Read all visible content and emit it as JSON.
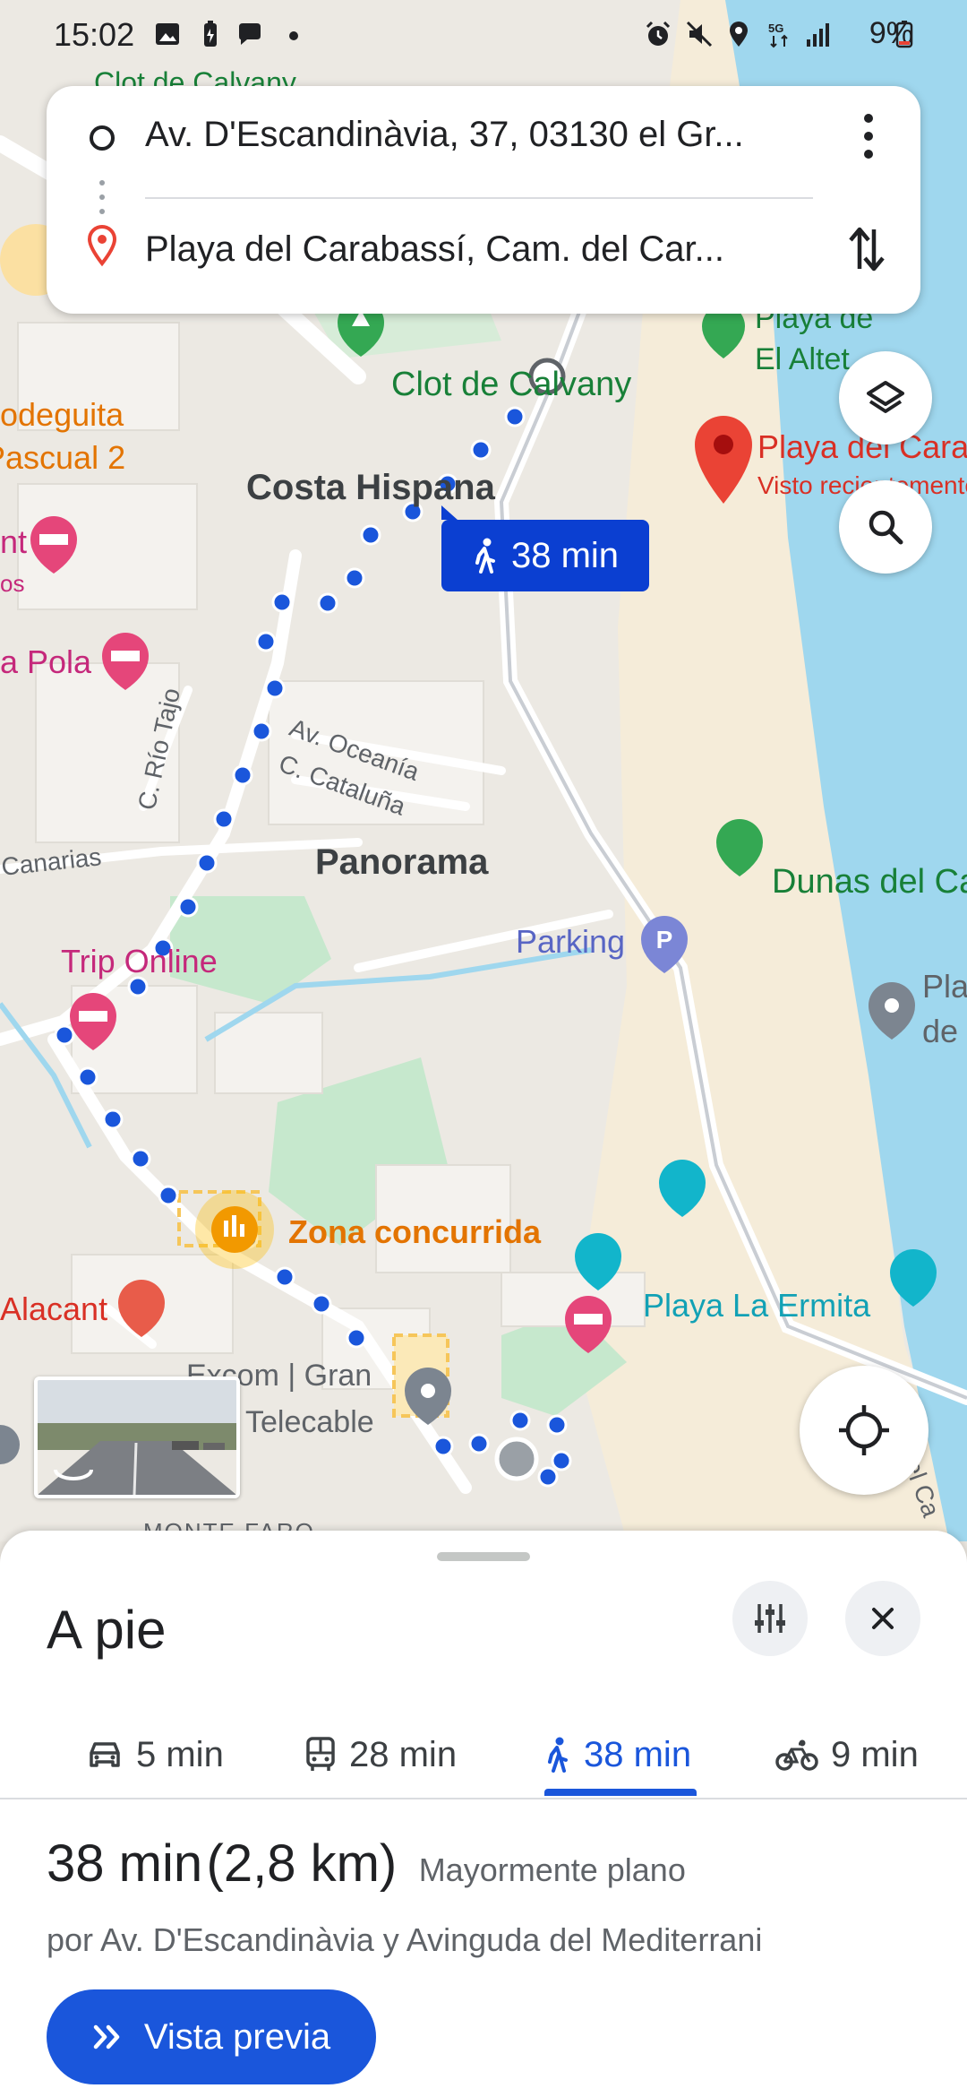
{
  "status_bar": {
    "time": "15:02",
    "battery": "9%",
    "icons": [
      "image-icon",
      "battery-saver-icon",
      "chat-icon",
      "dot-icon",
      "alarm-icon",
      "mute-icon",
      "location-icon",
      "5g-icon",
      "signal-icon",
      "battery-icon"
    ]
  },
  "route": {
    "origin": "Av. D'Escandinàvia, 37, 03130 el Gr...",
    "destination": "Playa del Carabassí, Cam. del Car..."
  },
  "map": {
    "eta_chip": "38 min",
    "labels": {
      "clot_top": "Clot de Calvany",
      "clot": "Clot de Calvany",
      "playa_altet": "Playa de",
      "playa_altet2": "El Altet",
      "playa_carabassi": "Playa del Cara",
      "visto": "Visto recientemente",
      "bodeguita": "Bodeguita",
      "pascual": "Pascual 2",
      "costa_hispana": "Costa Hispana",
      "nt": "nt",
      "os": "os",
      "la_pola": "a Pola",
      "rio_tajo": "C. Río Tajo",
      "av_oceania": "Av. Oceanía",
      "c_cataluna": "C. Cataluña",
      "canarias": "Canarias",
      "panorama": "Panorama",
      "dunas": "Dunas del Ca",
      "parking": "Parking",
      "pla": "Pla",
      "de": "de",
      "trip_online": "Trip Online",
      "zona": "Zona concurrida",
      "alacant": "Alacant",
      "playa_ermita": "Playa La Ermita",
      "excom": "Excom | Gran",
      "telecable": "Telecable",
      "del_ca": "del Ca",
      "monte": "MONTE FARO"
    }
  },
  "sheet": {
    "title": "A pie",
    "tabs": [
      {
        "icon": "car-icon",
        "label": "5 min"
      },
      {
        "icon": "bus-icon",
        "label": "28 min"
      },
      {
        "icon": "walk-icon",
        "label": "38 min"
      },
      {
        "icon": "bike-icon",
        "label": "9 min"
      }
    ],
    "active_tab": "walk",
    "duration": "38 min",
    "distance": "(2,8 km)",
    "terrain": "Mayormente plano",
    "via": "por Av. D'Escandinàvia y Avinguda del Mediterrani",
    "preview_label": "Vista previa"
  },
  "colors": {
    "accent": "#1a56db",
    "route_dot": "#1a56db",
    "sea": "#9fd7ee",
    "beach": "#f5ecd9",
    "park": "#c6e8cd",
    "destination_pin": "#ea4335"
  }
}
